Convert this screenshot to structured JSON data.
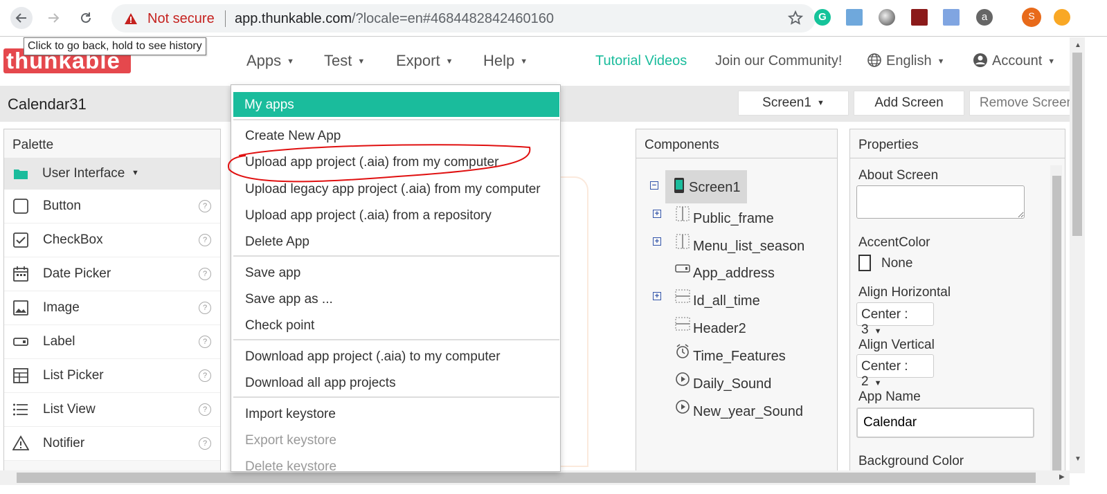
{
  "browser": {
    "security_label": "Not secure",
    "url_host": "app.thunkable.com",
    "url_rest": "/?locale=en#4684482842460160",
    "tooltip": "Click to go back, hold to see history",
    "profile_initial": "S"
  },
  "app": {
    "logo": "thunkable",
    "menus": [
      "Apps",
      "Test",
      "Export",
      "Help"
    ],
    "tutorial": "Tutorial Videos",
    "community": "Join our Community!",
    "language": "English",
    "account": "Account",
    "colors": {
      "accent": "#1abc9c",
      "brand": "#e5484d"
    }
  },
  "project": {
    "name": "Calendar31",
    "screen": "Screen1",
    "add_screen": "Add Screen",
    "remove_screen": "Remove Screen"
  },
  "palette": {
    "title": "Palette",
    "category": "User Interface",
    "items": [
      "Button",
      "CheckBox",
      "Date Picker",
      "Image",
      "Label",
      "List Picker",
      "List View",
      "Notifier"
    ]
  },
  "apps_menu": {
    "active": "My apps",
    "group1": [
      "Create New App",
      "Upload app project (.aia) from my computer",
      "Upload legacy app project (.aia) from my computer",
      "Upload app project (.aia) from a repository",
      "Delete App"
    ],
    "group2": [
      "Save app",
      "Save app as ...",
      "Check point"
    ],
    "group3": [
      "Download app project (.aia) to my computer",
      "Download all app projects"
    ],
    "group4": [
      "Import keystore",
      "Export keystore",
      "Delete keystore"
    ]
  },
  "components": {
    "title": "Components",
    "root": "Screen1",
    "children": [
      "Public_frame",
      "Menu_list_season",
      "App_address",
      "Id_all_time",
      "Header2",
      "Time_Features",
      "Daily_Sound",
      "New_year_Sound"
    ]
  },
  "properties": {
    "title": "Properties",
    "about_label": "About Screen",
    "about_value": "",
    "accent_label": "AccentColor",
    "accent_value": "None",
    "align_h_label": "Align Horizontal",
    "align_h_value": "Center : 3",
    "align_v_label": "Align Vertical",
    "align_v_value": "Center : 2",
    "app_name_label": "App Name",
    "app_name_value": "Calendar",
    "bg_label": "Background Color"
  }
}
